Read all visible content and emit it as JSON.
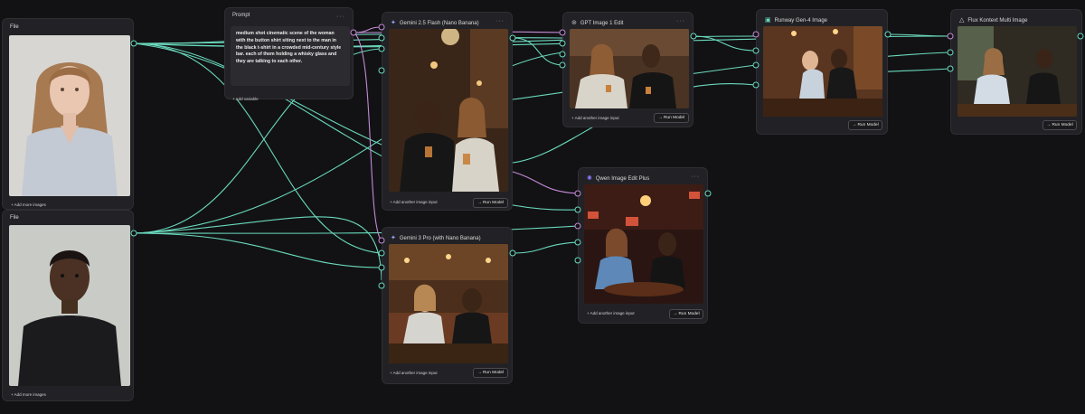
{
  "colors": {
    "canvas": "#121214",
    "node": "#222226",
    "wire_teal": "#6ad9bd",
    "wire_pink": "#c58ad6"
  },
  "file_nodes": [
    {
      "title": "File",
      "add_label": "+ Add more images",
      "image": "portrait of a young woman with long hair in a light button shirt"
    },
    {
      "title": "File",
      "add_label": "+ Add more images",
      "image": "portrait of a young man in a black t-shirt"
    }
  ],
  "prompt_node": {
    "title": "Prompt",
    "text": "medium shot cinematic scene of the woman with the button shirt siting next to the man in the black t-shirt in a crowded mid-century style bar. each of them holding a whisky glass and they are talking to each other.",
    "add_variable": "+ Add variable"
  },
  "model_nodes": {
    "gemini_flash": {
      "title": "Gemini 2.5 Flash (Nano Banana)",
      "icon": "sparkle-icon",
      "add_label": "+ Add another image input",
      "run": "→ Run Model"
    },
    "gemini_pro": {
      "title": "Gemini 3 Pro (with Nano Banana)",
      "icon": "sparkle-icon",
      "add_label": "+ Add another image input",
      "run": "→ Run Model"
    },
    "gpt_image": {
      "title": "GPT Image 1 Edit",
      "icon": "openai-icon",
      "add_label": "+ Add another image input",
      "run": "→ Run Model"
    },
    "qwen": {
      "title": "Qwen Image Edit Plus",
      "icon": "qwen-icon",
      "add_label": "+ Add another image input",
      "run": "→ Run Model"
    },
    "runway": {
      "title": "Runway Gen-4 Image",
      "icon": "runway-icon",
      "run": "→ Run Model"
    },
    "flux": {
      "title": "Flux Kontext Multi Image",
      "icon": "flux-icon",
      "run": "→ Run Model"
    }
  },
  "more_label": "···"
}
